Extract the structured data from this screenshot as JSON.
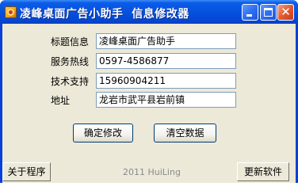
{
  "window": {
    "title": "凌峰桌面广告小助手  信息修改器"
  },
  "form": {
    "title_label": "标题信息",
    "title_value": "凌峰桌面广告助手",
    "hotline_label": "服务热线",
    "hotline_value": "0597-4586877",
    "support_label": "技术支持",
    "support_value": "15960904211",
    "address_label": "地址",
    "address_value": "龙岩市武平县岩前镇"
  },
  "buttons": {
    "confirm": "确定修改",
    "clear": "清空数据",
    "about": "关于程序",
    "update": "更新软件"
  },
  "footer": {
    "credit": "2011 HuiLing"
  },
  "colors": {
    "titlebar": "#0552de",
    "client_bg": "#ece9d8",
    "close_button": "#e35a32"
  },
  "icons": {
    "app": "app-icon",
    "minimize": "minimize-icon",
    "maximize": "maximize-icon",
    "close": "close-icon"
  }
}
